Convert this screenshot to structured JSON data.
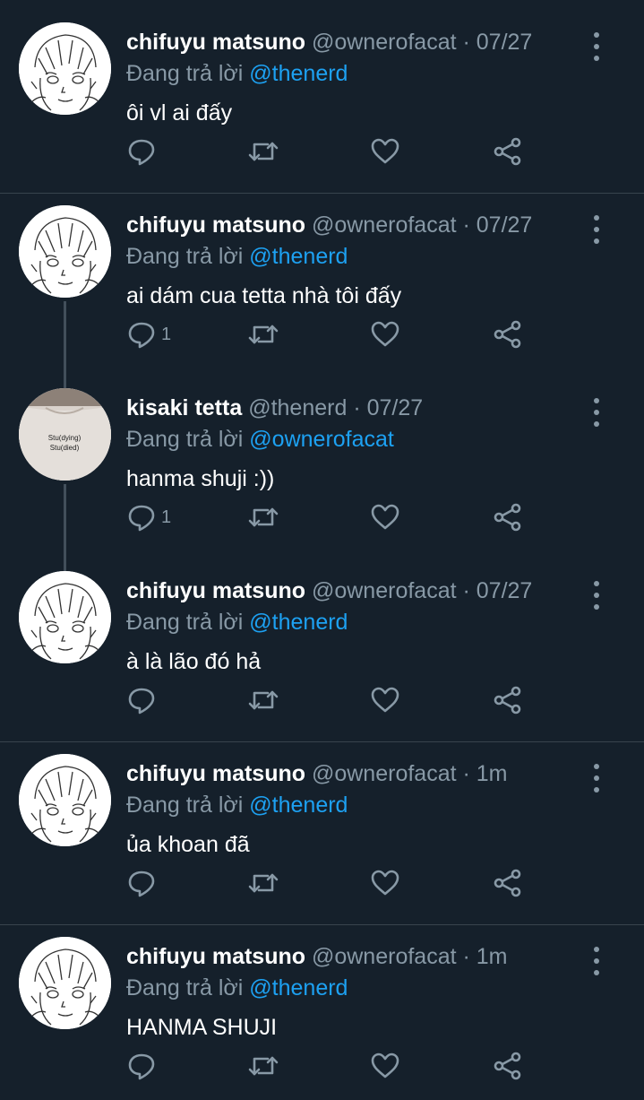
{
  "replying_label": "Đang trả lời",
  "colors": {
    "background": "#15202b",
    "divider": "#38444d",
    "secondary_text": "#8899a6",
    "mention": "#1da1f2",
    "primary_text": "#ffffff"
  },
  "icons": {
    "reply": "reply-icon",
    "retweet": "retweet-icon",
    "like": "like-icon",
    "share": "share-icon",
    "more": "more-vertical-icon"
  },
  "tweets": [
    {
      "avatar": "manga-avatar",
      "name": "chifuyu matsuno",
      "handle": "@ownerofacat",
      "time": "· 07/27",
      "replying_to": "@thenerd",
      "text": "ôi vl ai đấy",
      "reply_count": ""
    },
    {
      "avatar": "manga-avatar",
      "name": "chifuyu matsuno",
      "handle": "@ownerofacat",
      "time": "· 07/27",
      "replying_to": "@thenerd",
      "text": "ai dám cua tetta nhà tôi đấy",
      "reply_count": "1"
    },
    {
      "avatar": "shirt-avatar",
      "avatar_text": [
        "Stu(dying)",
        "Stu(died)"
      ],
      "name": "kisaki tetta",
      "handle": "@thenerd",
      "time": "· 07/27",
      "replying_to": "@ownerofacat",
      "text": "hanma shuji :))",
      "reply_count": "1"
    },
    {
      "avatar": "manga-avatar",
      "name": "chifuyu matsuno",
      "handle": "@ownerofacat",
      "time": "· 07/27",
      "replying_to": "@thenerd",
      "text": "à là lão đó hả",
      "reply_count": ""
    },
    {
      "avatar": "manga-avatar",
      "name": "chifuyu matsuno",
      "handle": "@ownerofacat",
      "time": "· 1m",
      "replying_to": "@thenerd",
      "text": "ủa khoan đã",
      "reply_count": ""
    },
    {
      "avatar": "manga-avatar",
      "name": "chifuyu matsuno",
      "handle": "@ownerofacat",
      "time": "· 1m",
      "replying_to": "@thenerd",
      "text": "HANMA SHUJI",
      "reply_count": ""
    }
  ]
}
